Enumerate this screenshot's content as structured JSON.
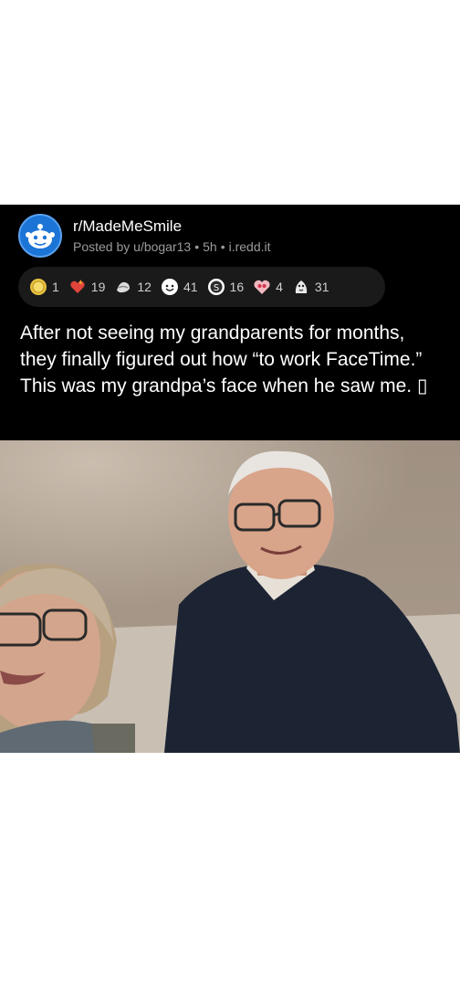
{
  "post": {
    "subreddit": "r/MadeMeSmile",
    "meta": {
      "posted_by": "Posted by u/bogar13",
      "age": "5h",
      "domain": "i.redd.it",
      "separator": "•"
    },
    "awards": [
      {
        "icon": "gold-coin-icon",
        "count": "1"
      },
      {
        "icon": "fire-heart-icon",
        "count": "19"
      },
      {
        "icon": "hugz-icon",
        "count": "12"
      },
      {
        "icon": "wholesome-face-icon",
        "count": "41"
      },
      {
        "icon": "silver-badge-icon",
        "count": "16"
      },
      {
        "icon": "heart-eyes-icon",
        "count": "4"
      },
      {
        "icon": "wholesome-seal-icon",
        "count": "31"
      }
    ],
    "title": "After not seeing my grandparents for months, they finally figured out how “to work FaceTime.” This was my grandpa’s face when he saw me. ▯",
    "colors": {
      "background": "#000000",
      "meta_text": "#9a9a9a",
      "avatar": "#1b74d6"
    }
  }
}
